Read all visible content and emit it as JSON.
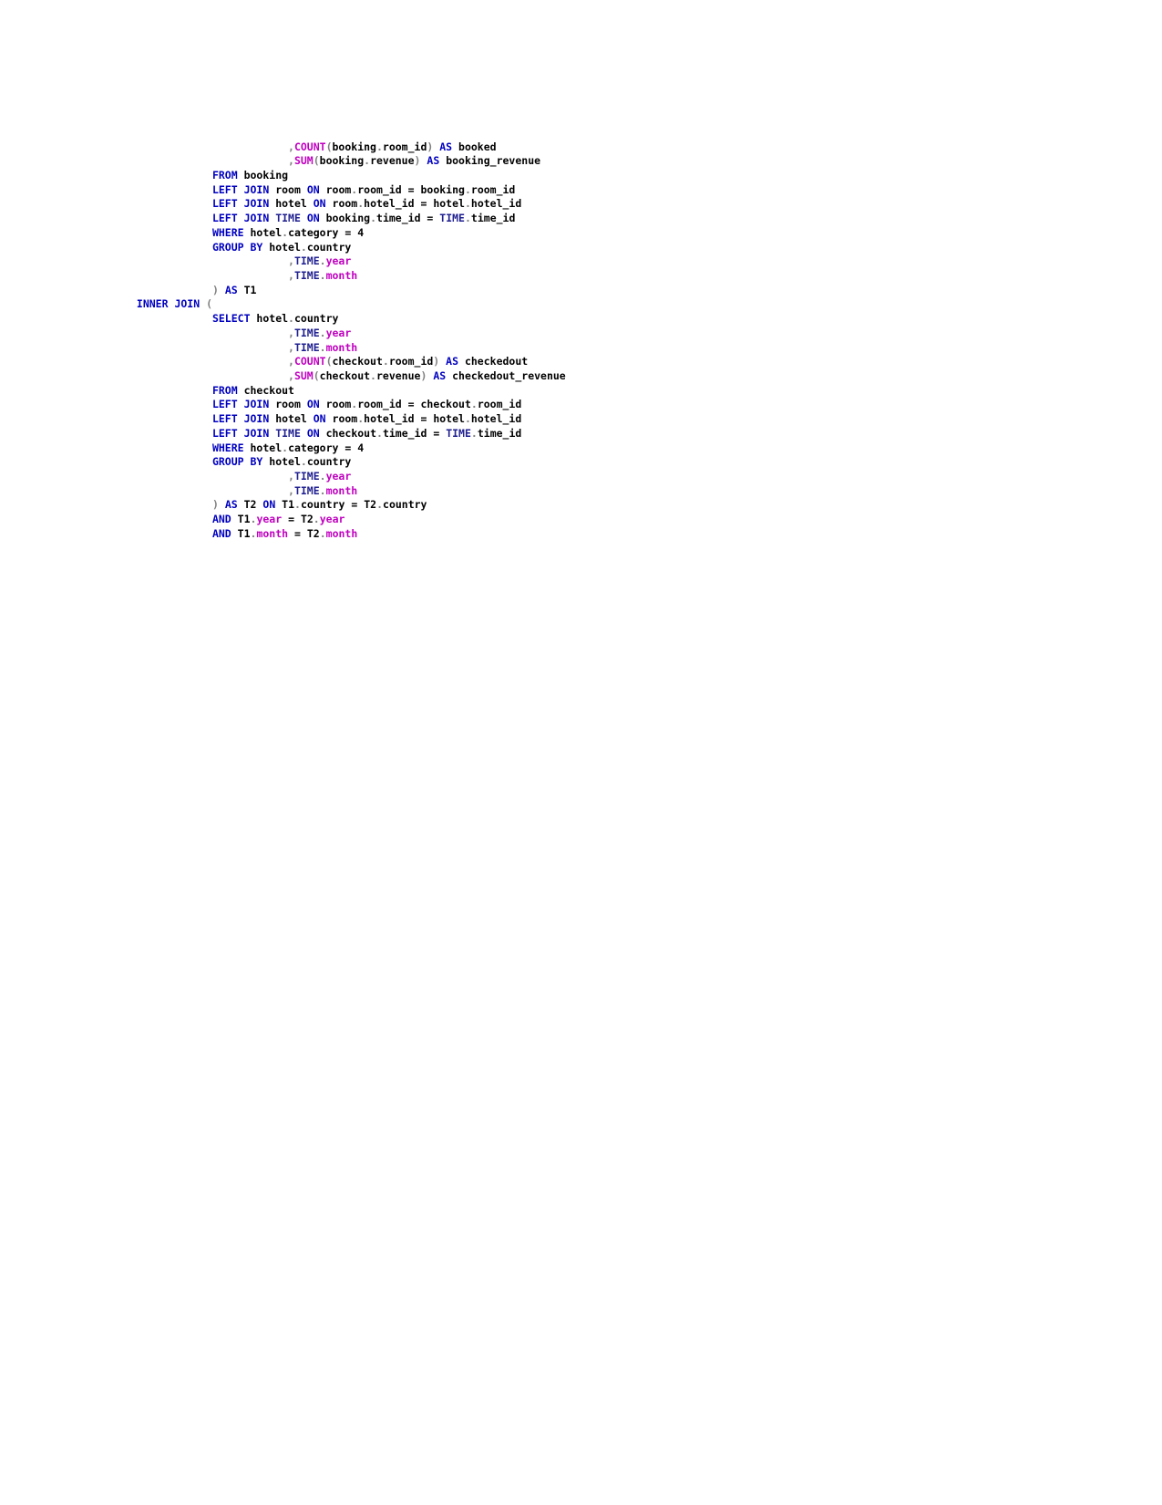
{
  "document": {
    "type": "sql-code-listing",
    "background_color": "#ffffff",
    "font_weight": "bold",
    "colors": {
      "keyword": "#0000c0",
      "function": "#c000c0",
      "time_table": "#202090",
      "highlighted_column": "#c000c0",
      "identifier": "#000000",
      "punctuation": "#808080",
      "operator": "#000000"
    }
  },
  "code": {
    "language": "sql",
    "plain_text": ",COUNT(booking.room_id) AS booked\n,SUM(booking.revenue) AS booking_revenue\nFROM booking\nLEFT JOIN room ON room.room_id = booking.room_id\nLEFT JOIN hotel ON room.hotel_id = hotel.hotel_id\nLEFT JOIN TIME ON booking.time_id = TIME.time_id\nWHERE hotel.category = 4\nGROUP BY hotel.country\n,TIME.year\n,TIME.month\n) AS T1\nINNER JOIN (\nSELECT hotel.country\n,TIME.year\n,TIME.month\n,COUNT(checkout.room_id) AS checkedout\n,SUM(checkout.revenue) AS checkedout_revenue\nFROM checkout\nLEFT JOIN room ON room.room_id = checkout.room_id\nLEFT JOIN hotel ON room.hotel_id = hotel.hotel_id\nLEFT JOIN TIME ON checkout.time_id = TIME.time_id\nWHERE hotel.category = 4\nGROUP BY hotel.country\n,TIME.year\n,TIME.month\n) AS T2 ON T1.country = T2.country\nAND T1.year = T2.year\nAND T1.month = T2.month",
    "lines": [
      {
        "indent": 12,
        "tokens": [
          {
            "t": ",",
            "c": "pun"
          },
          {
            "t": "COUNT",
            "c": "fn"
          },
          {
            "t": "(",
            "c": "pun"
          },
          {
            "t": "booking",
            "c": "id"
          },
          {
            "t": ".",
            "c": "pun"
          },
          {
            "t": "room_id",
            "c": "id"
          },
          {
            "t": ")",
            "c": "pun"
          },
          {
            "t": " ",
            "c": "id"
          },
          {
            "t": "AS",
            "c": "kw"
          },
          {
            "t": " booked",
            "c": "id"
          }
        ]
      },
      {
        "indent": 12,
        "tokens": [
          {
            "t": ",",
            "c": "pun"
          },
          {
            "t": "SUM",
            "c": "fn"
          },
          {
            "t": "(",
            "c": "pun"
          },
          {
            "t": "booking",
            "c": "id"
          },
          {
            "t": ".",
            "c": "pun"
          },
          {
            "t": "revenue",
            "c": "id"
          },
          {
            "t": ")",
            "c": "pun"
          },
          {
            "t": " ",
            "c": "id"
          },
          {
            "t": "AS",
            "c": "kw"
          },
          {
            "t": " booking_revenue",
            "c": "id"
          }
        ]
      },
      {
        "indent": 0,
        "tokens": [
          {
            "t": "FROM",
            "c": "kw"
          },
          {
            "t": " booking",
            "c": "id"
          }
        ]
      },
      {
        "indent": 0,
        "tokens": [
          {
            "t": "LEFT JOIN",
            "c": "kw"
          },
          {
            "t": " room ",
            "c": "id"
          },
          {
            "t": "ON",
            "c": "kw"
          },
          {
            "t": " room",
            "c": "id"
          },
          {
            "t": ".",
            "c": "pun"
          },
          {
            "t": "room_id",
            "c": "id"
          },
          {
            "t": " = ",
            "c": "op"
          },
          {
            "t": "booking",
            "c": "id"
          },
          {
            "t": ".",
            "c": "pun"
          },
          {
            "t": "room_id",
            "c": "id"
          }
        ]
      },
      {
        "indent": 0,
        "tokens": [
          {
            "t": "LEFT JOIN",
            "c": "kw"
          },
          {
            "t": " hotel ",
            "c": "id"
          },
          {
            "t": "ON",
            "c": "kw"
          },
          {
            "t": " room",
            "c": "id"
          },
          {
            "t": ".",
            "c": "pun"
          },
          {
            "t": "hotel_id",
            "c": "id"
          },
          {
            "t": " = ",
            "c": "op"
          },
          {
            "t": "hotel",
            "c": "id"
          },
          {
            "t": ".",
            "c": "pun"
          },
          {
            "t": "hotel_id",
            "c": "id"
          }
        ]
      },
      {
        "indent": 0,
        "tokens": [
          {
            "t": "LEFT JOIN",
            "c": "kw"
          },
          {
            "t": " ",
            "c": "id"
          },
          {
            "t": "TIME",
            "c": "tbl"
          },
          {
            "t": " ",
            "c": "id"
          },
          {
            "t": "ON",
            "c": "kw"
          },
          {
            "t": " booking",
            "c": "id"
          },
          {
            "t": ".",
            "c": "pun"
          },
          {
            "t": "time_id",
            "c": "id"
          },
          {
            "t": " = ",
            "c": "op"
          },
          {
            "t": "TIME",
            "c": "tbl"
          },
          {
            "t": ".",
            "c": "pun"
          },
          {
            "t": "time_id",
            "c": "id"
          }
        ]
      },
      {
        "indent": 0,
        "tokens": [
          {
            "t": "WHERE",
            "c": "kw"
          },
          {
            "t": " hotel",
            "c": "id"
          },
          {
            "t": ".",
            "c": "pun"
          },
          {
            "t": "category",
            "c": "id"
          },
          {
            "t": " = ",
            "c": "op"
          },
          {
            "t": "4",
            "c": "num"
          }
        ]
      },
      {
        "indent": 0,
        "tokens": [
          {
            "t": "GROUP BY",
            "c": "kw"
          },
          {
            "t": " hotel",
            "c": "id"
          },
          {
            "t": ".",
            "c": "pun"
          },
          {
            "t": "country",
            "c": "id"
          }
        ]
      },
      {
        "indent": 12,
        "tokens": [
          {
            "t": ",",
            "c": "pun"
          },
          {
            "t": "TIME",
            "c": "tbl"
          },
          {
            "t": ".",
            "c": "pun"
          },
          {
            "t": "year",
            "c": "col"
          }
        ]
      },
      {
        "indent": 12,
        "tokens": [
          {
            "t": ",",
            "c": "pun"
          },
          {
            "t": "TIME",
            "c": "tbl"
          },
          {
            "t": ".",
            "c": "pun"
          },
          {
            "t": "month",
            "c": "col"
          }
        ]
      },
      {
        "indent": 0,
        "tokens": [
          {
            "t": ")",
            "c": "pun"
          },
          {
            "t": " ",
            "c": "id"
          },
          {
            "t": "AS",
            "c": "kw"
          },
          {
            "t": " T1",
            "c": "id"
          }
        ]
      },
      {
        "indent": -12,
        "tokens": [
          {
            "t": "INNER JOIN",
            "c": "kw"
          },
          {
            "t": " ",
            "c": "id"
          },
          {
            "t": "(",
            "c": "pun"
          }
        ]
      },
      {
        "indent": 0,
        "tokens": [
          {
            "t": "SELECT",
            "c": "kw"
          },
          {
            "t": " hotel",
            "c": "id"
          },
          {
            "t": ".",
            "c": "pun"
          },
          {
            "t": "country",
            "c": "id"
          }
        ]
      },
      {
        "indent": 12,
        "tokens": [
          {
            "t": ",",
            "c": "pun"
          },
          {
            "t": "TIME",
            "c": "tbl"
          },
          {
            "t": ".",
            "c": "pun"
          },
          {
            "t": "year",
            "c": "col"
          }
        ]
      },
      {
        "indent": 12,
        "tokens": [
          {
            "t": ",",
            "c": "pun"
          },
          {
            "t": "TIME",
            "c": "tbl"
          },
          {
            "t": ".",
            "c": "pun"
          },
          {
            "t": "month",
            "c": "col"
          }
        ]
      },
      {
        "indent": 12,
        "tokens": [
          {
            "t": ",",
            "c": "pun"
          },
          {
            "t": "COUNT",
            "c": "fn"
          },
          {
            "t": "(",
            "c": "pun"
          },
          {
            "t": "checkout",
            "c": "id"
          },
          {
            "t": ".",
            "c": "pun"
          },
          {
            "t": "room_id",
            "c": "id"
          },
          {
            "t": ")",
            "c": "pun"
          },
          {
            "t": " ",
            "c": "id"
          },
          {
            "t": "AS",
            "c": "kw"
          },
          {
            "t": " checkedout",
            "c": "id"
          }
        ]
      },
      {
        "indent": 12,
        "tokens": [
          {
            "t": ",",
            "c": "pun"
          },
          {
            "t": "SUM",
            "c": "fn"
          },
          {
            "t": "(",
            "c": "pun"
          },
          {
            "t": "checkout",
            "c": "id"
          },
          {
            "t": ".",
            "c": "pun"
          },
          {
            "t": "revenue",
            "c": "id"
          },
          {
            "t": ")",
            "c": "pun"
          },
          {
            "t": " ",
            "c": "id"
          },
          {
            "t": "AS",
            "c": "kw"
          },
          {
            "t": " checkedout_revenue",
            "c": "id"
          }
        ]
      },
      {
        "indent": 0,
        "tokens": [
          {
            "t": "FROM",
            "c": "kw"
          },
          {
            "t": " checkout",
            "c": "id"
          }
        ]
      },
      {
        "indent": 0,
        "tokens": [
          {
            "t": "LEFT JOIN",
            "c": "kw"
          },
          {
            "t": " room ",
            "c": "id"
          },
          {
            "t": "ON",
            "c": "kw"
          },
          {
            "t": " room",
            "c": "id"
          },
          {
            "t": ".",
            "c": "pun"
          },
          {
            "t": "room_id",
            "c": "id"
          },
          {
            "t": " = ",
            "c": "op"
          },
          {
            "t": "checkout",
            "c": "id"
          },
          {
            "t": ".",
            "c": "pun"
          },
          {
            "t": "room_id",
            "c": "id"
          }
        ]
      },
      {
        "indent": 0,
        "tokens": [
          {
            "t": "LEFT JOIN",
            "c": "kw"
          },
          {
            "t": " hotel ",
            "c": "id"
          },
          {
            "t": "ON",
            "c": "kw"
          },
          {
            "t": " room",
            "c": "id"
          },
          {
            "t": ".",
            "c": "pun"
          },
          {
            "t": "hotel_id",
            "c": "id"
          },
          {
            "t": " = ",
            "c": "op"
          },
          {
            "t": "hotel",
            "c": "id"
          },
          {
            "t": ".",
            "c": "pun"
          },
          {
            "t": "hotel_id",
            "c": "id"
          }
        ]
      },
      {
        "indent": 0,
        "tokens": [
          {
            "t": "LEFT JOIN",
            "c": "kw"
          },
          {
            "t": " ",
            "c": "id"
          },
          {
            "t": "TIME",
            "c": "tbl"
          },
          {
            "t": " ",
            "c": "id"
          },
          {
            "t": "ON",
            "c": "kw"
          },
          {
            "t": " checkout",
            "c": "id"
          },
          {
            "t": ".",
            "c": "pun"
          },
          {
            "t": "time_id",
            "c": "id"
          },
          {
            "t": " = ",
            "c": "op"
          },
          {
            "t": "TIME",
            "c": "tbl"
          },
          {
            "t": ".",
            "c": "pun"
          },
          {
            "t": "time_id",
            "c": "id"
          }
        ]
      },
      {
        "indent": 0,
        "tokens": [
          {
            "t": "WHERE",
            "c": "kw"
          },
          {
            "t": " hotel",
            "c": "id"
          },
          {
            "t": ".",
            "c": "pun"
          },
          {
            "t": "category",
            "c": "id"
          },
          {
            "t": " = ",
            "c": "op"
          },
          {
            "t": "4",
            "c": "num"
          }
        ]
      },
      {
        "indent": 0,
        "tokens": [
          {
            "t": "GROUP BY",
            "c": "kw"
          },
          {
            "t": " hotel",
            "c": "id"
          },
          {
            "t": ".",
            "c": "pun"
          },
          {
            "t": "country",
            "c": "id"
          }
        ]
      },
      {
        "indent": 12,
        "tokens": [
          {
            "t": ",",
            "c": "pun"
          },
          {
            "t": "TIME",
            "c": "tbl"
          },
          {
            "t": ".",
            "c": "pun"
          },
          {
            "t": "year",
            "c": "col"
          }
        ]
      },
      {
        "indent": 12,
        "tokens": [
          {
            "t": ",",
            "c": "pun"
          },
          {
            "t": "TIME",
            "c": "tbl"
          },
          {
            "t": ".",
            "c": "pun"
          },
          {
            "t": "month",
            "c": "col"
          }
        ]
      },
      {
        "indent": 0,
        "tokens": [
          {
            "t": ")",
            "c": "pun"
          },
          {
            "t": " ",
            "c": "id"
          },
          {
            "t": "AS",
            "c": "kw"
          },
          {
            "t": " T2 ",
            "c": "id"
          },
          {
            "t": "ON",
            "c": "kw"
          },
          {
            "t": " T1",
            "c": "id"
          },
          {
            "t": ".",
            "c": "pun"
          },
          {
            "t": "country",
            "c": "id"
          },
          {
            "t": " = ",
            "c": "op"
          },
          {
            "t": "T2",
            "c": "id"
          },
          {
            "t": ".",
            "c": "pun"
          },
          {
            "t": "country",
            "c": "id"
          }
        ]
      },
      {
        "indent": 0,
        "tokens": [
          {
            "t": "AND",
            "c": "kw"
          },
          {
            "t": " T1",
            "c": "id"
          },
          {
            "t": ".",
            "c": "pun"
          },
          {
            "t": "year",
            "c": "col"
          },
          {
            "t": " = ",
            "c": "op"
          },
          {
            "t": "T2",
            "c": "id"
          },
          {
            "t": ".",
            "c": "pun"
          },
          {
            "t": "year",
            "c": "col"
          }
        ]
      },
      {
        "indent": 0,
        "tokens": [
          {
            "t": "AND",
            "c": "kw"
          },
          {
            "t": " T1",
            "c": "id"
          },
          {
            "t": ".",
            "c": "pun"
          },
          {
            "t": "month",
            "c": "col"
          },
          {
            "t": " = ",
            "c": "op"
          },
          {
            "t": "T2",
            "c": "id"
          },
          {
            "t": ".",
            "c": "pun"
          },
          {
            "t": "month",
            "c": "col"
          }
        ]
      }
    ]
  }
}
